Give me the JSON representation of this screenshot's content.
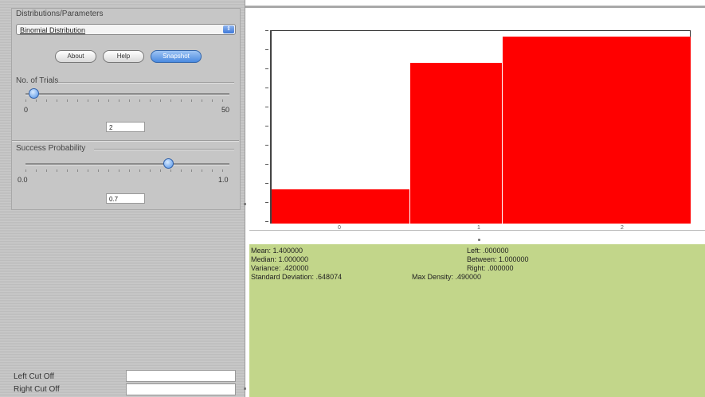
{
  "left_panel": {
    "group_title": "Distributions/Parameters",
    "distribution": "Binomial Distribution",
    "buttons": {
      "about": "About",
      "help": "Help",
      "snapshot": "Snapshot"
    },
    "trials": {
      "label": "No. of Trials",
      "min": "0",
      "max": "50",
      "value": "2",
      "fraction": 0.04
    },
    "success": {
      "label": "Success Probability",
      "min": "0.0",
      "max": "1.0",
      "value": "0.7",
      "fraction": 0.7
    },
    "left_cut_label": "Left Cut Off",
    "right_cut_label": "Right Cut Off"
  },
  "chart_data": {
    "type": "bar",
    "categories": [
      "0",
      "1",
      "2"
    ],
    "values": [
      0.09,
      0.42,
      0.49
    ],
    "ylim": [
      0,
      0.5
    ],
    "x_tick_labels": [
      "0",
      "1",
      "2"
    ],
    "bar_color": "#ff0000"
  },
  "stats": {
    "mean": "Mean: 1.400000",
    "median": "Median: 1.000000",
    "variance": "Variance: .420000",
    "sd": "Standard Deviation: .648074",
    "left": "Left: .000000",
    "between": "Between: 1.000000",
    "right": "Right: .000000",
    "max_density": "Max Density: .490000"
  },
  "colors": {
    "stats_background": "#c2d68a",
    "accent": "#4a8ae0"
  }
}
